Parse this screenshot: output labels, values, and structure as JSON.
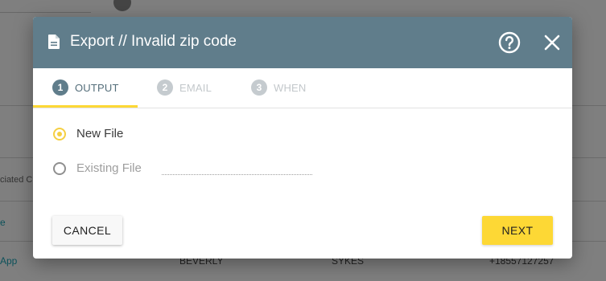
{
  "background": {
    "column_header_partial": "ciated C",
    "link_partial_1": "e",
    "link_partial_2": "App",
    "row_first_name": "BEVERLY",
    "row_last_name": "SYKES",
    "row_phone": "+18557127257"
  },
  "dialog": {
    "title": "Export // Invalid zip code",
    "icons": {
      "title": "document-icon",
      "help": "help-circle-icon",
      "close": "close-icon"
    },
    "colors": {
      "header": "#607d8b",
      "accent": "#fdd835"
    },
    "steps": [
      {
        "number": "1",
        "label": "OUTPUT",
        "state": "active"
      },
      {
        "number": "2",
        "label": "EMAIL",
        "state": "inactive"
      },
      {
        "number": "3",
        "label": "WHEN",
        "state": "inactive"
      }
    ],
    "options": {
      "new_file": {
        "label": "New File",
        "checked": true
      },
      "existing_file": {
        "label": "Existing File",
        "checked": false
      }
    },
    "buttons": {
      "cancel": "CANCEL",
      "next": "NEXT"
    }
  }
}
